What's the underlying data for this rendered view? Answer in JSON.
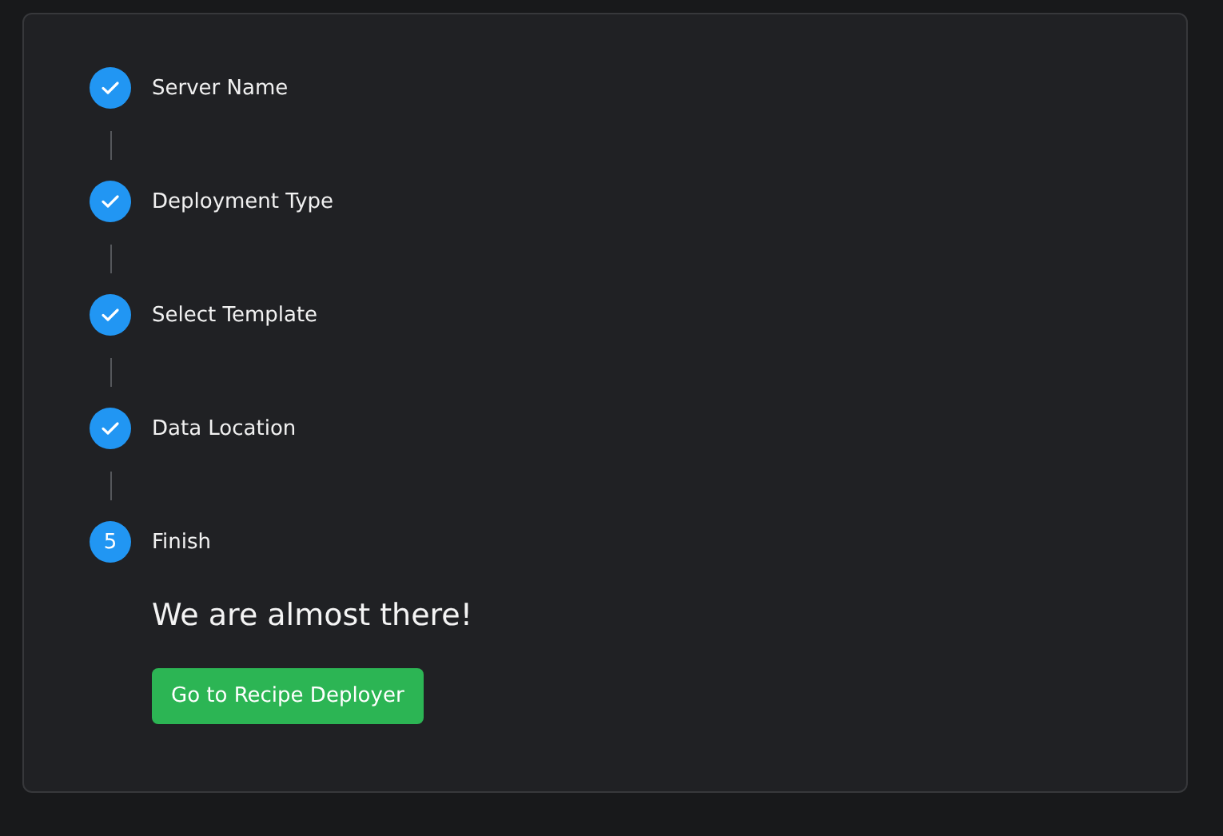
{
  "steps": [
    {
      "label": "Server Name",
      "completed": true
    },
    {
      "label": "Deployment Type",
      "completed": true
    },
    {
      "label": "Select Template",
      "completed": true
    },
    {
      "label": "Data Location",
      "completed": true
    },
    {
      "label": "Finish",
      "completed": false,
      "number": "5"
    }
  ],
  "heading": "We are almost there!",
  "button": "Go to Recipe Deployer"
}
